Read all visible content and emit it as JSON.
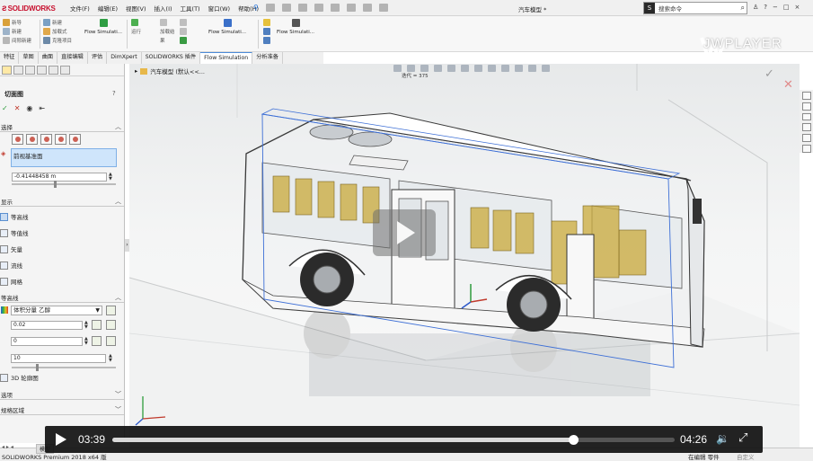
{
  "app": {
    "logo_text": "SOLIDWORKS",
    "menu": [
      "文件(F)",
      "编辑(E)",
      "视图(V)",
      "插入(I)",
      "工具(T)",
      "窗口(W)",
      "帮助(H)"
    ],
    "doc_title": "汽车模型 *",
    "search_placeholder": "搜索命令",
    "watermark": "JWPLAYER"
  },
  "ribbon": {
    "left_items": [
      "新导",
      "新建",
      "间隙新建"
    ],
    "group2_items": [
      "新建",
      "加载式",
      "克隆项目"
    ],
    "group3_items": [
      "运行",
      "加载结",
      "果"
    ],
    "flow_label": "Flow Simulati..."
  },
  "tabs": [
    "特征",
    "草图",
    "曲面",
    "直接编辑",
    "评估",
    "DimXpert",
    "SOLIDWORKS 插件",
    "Flow Simulation",
    "分析准备"
  ],
  "active_tab": "Flow Simulation",
  "panel": {
    "title": "切面图",
    "help": "?",
    "section_selection": "选择",
    "selected_plane": "前视基准面",
    "offset_value": "-0.41448458 m",
    "section_display": "显示",
    "display_items": [
      "等高线",
      "等值线",
      "矢量",
      "流线",
      "网格"
    ],
    "section_contours": "等高线",
    "parameter": "体积分量 乙醇",
    "val1": "0.02",
    "val2": "0",
    "val3": "10",
    "profile_3d": "3D 轮廓图",
    "section_options": "选项",
    "section_region": "规格区域"
  },
  "viewport": {
    "tree_label": "汽车模型 (默认<<...",
    "iteration": "迭代 = 375"
  },
  "player": {
    "current_time": "03:39",
    "duration": "04:26",
    "progress": 0.819
  },
  "status": {
    "left": "SOLIDWORKS Premium 2018 x64 版",
    "editing": "在编辑 零件",
    "custom": "自定义",
    "model_tab": "模型"
  }
}
